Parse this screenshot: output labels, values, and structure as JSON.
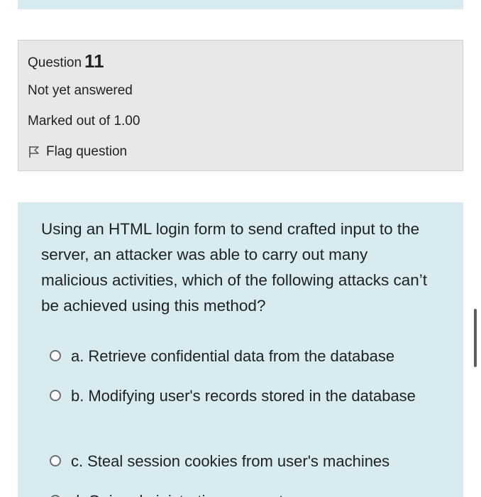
{
  "question_info": {
    "label": "Question",
    "number": "11",
    "state": "Not yet answered",
    "grade": "Marked out of 1.00",
    "flag_label": "Flag question"
  },
  "question": {
    "text": "Using an HTML login form to send crafted input to the server, an attacker was able to carry out many malicious activities, which of the following attacks can’t be achieved using this method?",
    "answers": [
      {
        "letter": "a.",
        "text": "Retrieve confidential data from the database"
      },
      {
        "letter": "b.",
        "text": "Modifying user's records stored in the database"
      },
      {
        "letter": "c.",
        "text": "Steal session cookies from user's machines"
      },
      {
        "letter": "d.",
        "text": "Gain administrative access to ..."
      }
    ]
  },
  "colors": {
    "info_background": "#e8e8e8",
    "content_background": "#d7ebf0",
    "text": "#1d2125"
  }
}
